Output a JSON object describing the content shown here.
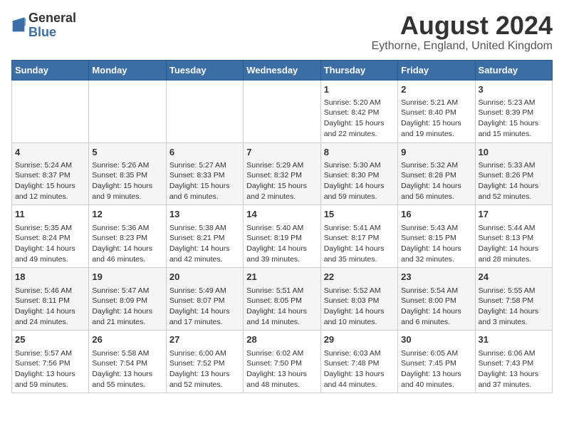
{
  "logo": {
    "general": "General",
    "blue": "Blue"
  },
  "title": "August 2024",
  "subtitle": "Eythorne, England, United Kingdom",
  "days_of_week": [
    "Sunday",
    "Monday",
    "Tuesday",
    "Wednesday",
    "Thursday",
    "Friday",
    "Saturday"
  ],
  "weeks": [
    [
      {
        "day": "",
        "info": ""
      },
      {
        "day": "",
        "info": ""
      },
      {
        "day": "",
        "info": ""
      },
      {
        "day": "",
        "info": ""
      },
      {
        "day": "1",
        "info": "Sunrise: 5:20 AM\nSunset: 8:42 PM\nDaylight: 15 hours\nand 22 minutes."
      },
      {
        "day": "2",
        "info": "Sunrise: 5:21 AM\nSunset: 8:40 PM\nDaylight: 15 hours\nand 19 minutes."
      },
      {
        "day": "3",
        "info": "Sunrise: 5:23 AM\nSunset: 8:39 PM\nDaylight: 15 hours\nand 15 minutes."
      }
    ],
    [
      {
        "day": "4",
        "info": "Sunrise: 5:24 AM\nSunset: 8:37 PM\nDaylight: 15 hours\nand 12 minutes."
      },
      {
        "day": "5",
        "info": "Sunrise: 5:26 AM\nSunset: 8:35 PM\nDaylight: 15 hours\nand 9 minutes."
      },
      {
        "day": "6",
        "info": "Sunrise: 5:27 AM\nSunset: 8:33 PM\nDaylight: 15 hours\nand 6 minutes."
      },
      {
        "day": "7",
        "info": "Sunrise: 5:29 AM\nSunset: 8:32 PM\nDaylight: 15 hours\nand 2 minutes."
      },
      {
        "day": "8",
        "info": "Sunrise: 5:30 AM\nSunset: 8:30 PM\nDaylight: 14 hours\nand 59 minutes."
      },
      {
        "day": "9",
        "info": "Sunrise: 5:32 AM\nSunset: 8:28 PM\nDaylight: 14 hours\nand 56 minutes."
      },
      {
        "day": "10",
        "info": "Sunrise: 5:33 AM\nSunset: 8:26 PM\nDaylight: 14 hours\nand 52 minutes."
      }
    ],
    [
      {
        "day": "11",
        "info": "Sunrise: 5:35 AM\nSunset: 8:24 PM\nDaylight: 14 hours\nand 49 minutes."
      },
      {
        "day": "12",
        "info": "Sunrise: 5:36 AM\nSunset: 8:23 PM\nDaylight: 14 hours\nand 46 minutes."
      },
      {
        "day": "13",
        "info": "Sunrise: 5:38 AM\nSunset: 8:21 PM\nDaylight: 14 hours\nand 42 minutes."
      },
      {
        "day": "14",
        "info": "Sunrise: 5:40 AM\nSunset: 8:19 PM\nDaylight: 14 hours\nand 39 minutes."
      },
      {
        "day": "15",
        "info": "Sunrise: 5:41 AM\nSunset: 8:17 PM\nDaylight: 14 hours\nand 35 minutes."
      },
      {
        "day": "16",
        "info": "Sunrise: 5:43 AM\nSunset: 8:15 PM\nDaylight: 14 hours\nand 32 minutes."
      },
      {
        "day": "17",
        "info": "Sunrise: 5:44 AM\nSunset: 8:13 PM\nDaylight: 14 hours\nand 28 minutes."
      }
    ],
    [
      {
        "day": "18",
        "info": "Sunrise: 5:46 AM\nSunset: 8:11 PM\nDaylight: 14 hours\nand 24 minutes."
      },
      {
        "day": "19",
        "info": "Sunrise: 5:47 AM\nSunset: 8:09 PM\nDaylight: 14 hours\nand 21 minutes."
      },
      {
        "day": "20",
        "info": "Sunrise: 5:49 AM\nSunset: 8:07 PM\nDaylight: 14 hours\nand 17 minutes."
      },
      {
        "day": "21",
        "info": "Sunrise: 5:51 AM\nSunset: 8:05 PM\nDaylight: 14 hours\nand 14 minutes."
      },
      {
        "day": "22",
        "info": "Sunrise: 5:52 AM\nSunset: 8:03 PM\nDaylight: 14 hours\nand 10 minutes."
      },
      {
        "day": "23",
        "info": "Sunrise: 5:54 AM\nSunset: 8:00 PM\nDaylight: 14 hours\nand 6 minutes."
      },
      {
        "day": "24",
        "info": "Sunrise: 5:55 AM\nSunset: 7:58 PM\nDaylight: 14 hours\nand 3 minutes."
      }
    ],
    [
      {
        "day": "25",
        "info": "Sunrise: 5:57 AM\nSunset: 7:56 PM\nDaylight: 13 hours\nand 59 minutes."
      },
      {
        "day": "26",
        "info": "Sunrise: 5:58 AM\nSunset: 7:54 PM\nDaylight: 13 hours\nand 55 minutes."
      },
      {
        "day": "27",
        "info": "Sunrise: 6:00 AM\nSunset: 7:52 PM\nDaylight: 13 hours\nand 52 minutes."
      },
      {
        "day": "28",
        "info": "Sunrise: 6:02 AM\nSunset: 7:50 PM\nDaylight: 13 hours\nand 48 minutes."
      },
      {
        "day": "29",
        "info": "Sunrise: 6:03 AM\nSunset: 7:48 PM\nDaylight: 13 hours\nand 44 minutes."
      },
      {
        "day": "30",
        "info": "Sunrise: 6:05 AM\nSunset: 7:45 PM\nDaylight: 13 hours\nand 40 minutes."
      },
      {
        "day": "31",
        "info": "Sunrise: 6:06 AM\nSunset: 7:43 PM\nDaylight: 13 hours\nand 37 minutes."
      }
    ]
  ]
}
